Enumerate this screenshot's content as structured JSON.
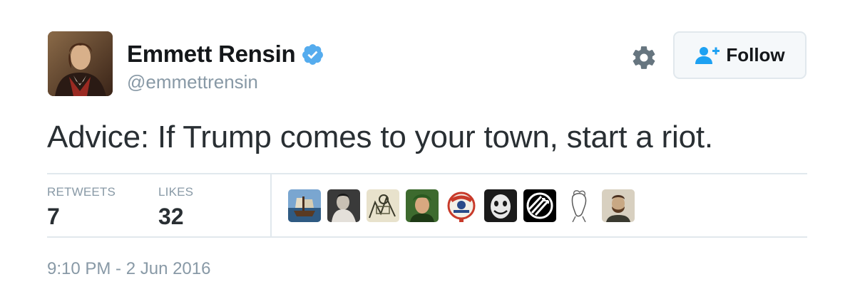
{
  "user": {
    "display_name": "Emmett Rensin",
    "handle": "@emmettrensin",
    "verified_icon": "verified-badge-icon",
    "verified_color": "#55acee"
  },
  "actions": {
    "settings_icon": "gear-icon",
    "follow_label": "Follow",
    "follow_icon": "add-user-icon",
    "follow_icon_color": "#1da1f2"
  },
  "tweet": {
    "text": "Advice: If Trump comes to your town, start a riot."
  },
  "stats": {
    "retweets_label": "RETWEETS",
    "retweets_value": "7",
    "likes_label": "LIKES",
    "likes_value": "32"
  },
  "timestamp": "9:10 PM - 2 Jun 2016",
  "colors": {
    "text_primary": "#292f33",
    "text_secondary": "#8899a6",
    "border": "#e1e8ed",
    "accent": "#1da1f2"
  }
}
